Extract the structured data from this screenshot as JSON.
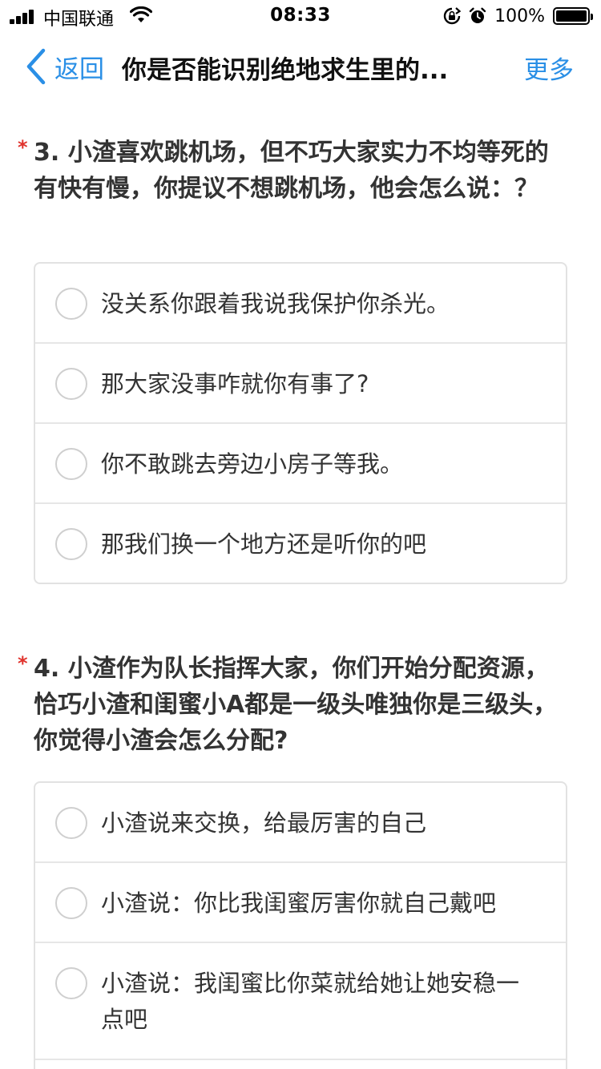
{
  "status_bar": {
    "carrier": "中国联通",
    "time": "08:33",
    "battery_percent": "100%",
    "battery_level": 1.0
  },
  "nav": {
    "back_label": "返回",
    "title": "你是否能识别绝地求生里的...",
    "more_label": "更多"
  },
  "questions": [
    {
      "star": "*",
      "text": "3. 小渣喜欢跳机场，但不巧大家实力不均等死的有快有慢，你提议不想跳机场，他会怎么说：？",
      "options": [
        "没关系你跟着我说我保护你杀光。",
        "那大家没事咋就你有事了?",
        "你不敢跳去旁边小房子等我。",
        "那我们换一个地方还是听你的吧"
      ]
    },
    {
      "star": "*",
      "text": "4. 小渣作为队长指挥大家，你们开始分配资源，恰巧小渣和闺蜜小A都是一级头唯独你是三级头，你觉得小渣会怎么分配?",
      "options": [
        "小渣说来交换，给最厉害的自己",
        "小渣说：你比我闺蜜厉害你就自己戴吧",
        "小渣说：我闺蜜比你菜就给她让她安稳一点吧"
      ]
    }
  ],
  "colors": {
    "accent": "#2a8fe6",
    "required_star": "#e0322c",
    "border": "#e2e2e2"
  }
}
